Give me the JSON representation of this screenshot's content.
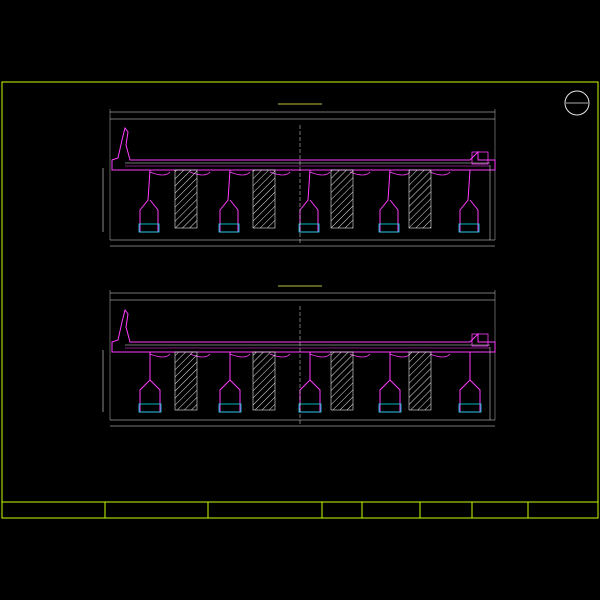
{
  "drawing": {
    "sheet_badge_top": "",
    "sheet_badge_bottom": "",
    "section1_title": "",
    "section2_title": "",
    "overall_width_dim": "",
    "mid_label": "",
    "notes_title": "",
    "notes": [
      "",
      ""
    ]
  },
  "title_block": {
    "project": "",
    "drawing_title": "",
    "design_label": "",
    "check_label": "",
    "review_label": "",
    "drawing_no_label": "",
    "date_label": ""
  },
  "colors": {
    "frame": "#c8ff00",
    "outline": "#ff3cff",
    "dimension": "#e6e6e6",
    "rebar": "#00e6e6",
    "title": "#ffff55",
    "hatch": "#e6e6e6"
  }
}
